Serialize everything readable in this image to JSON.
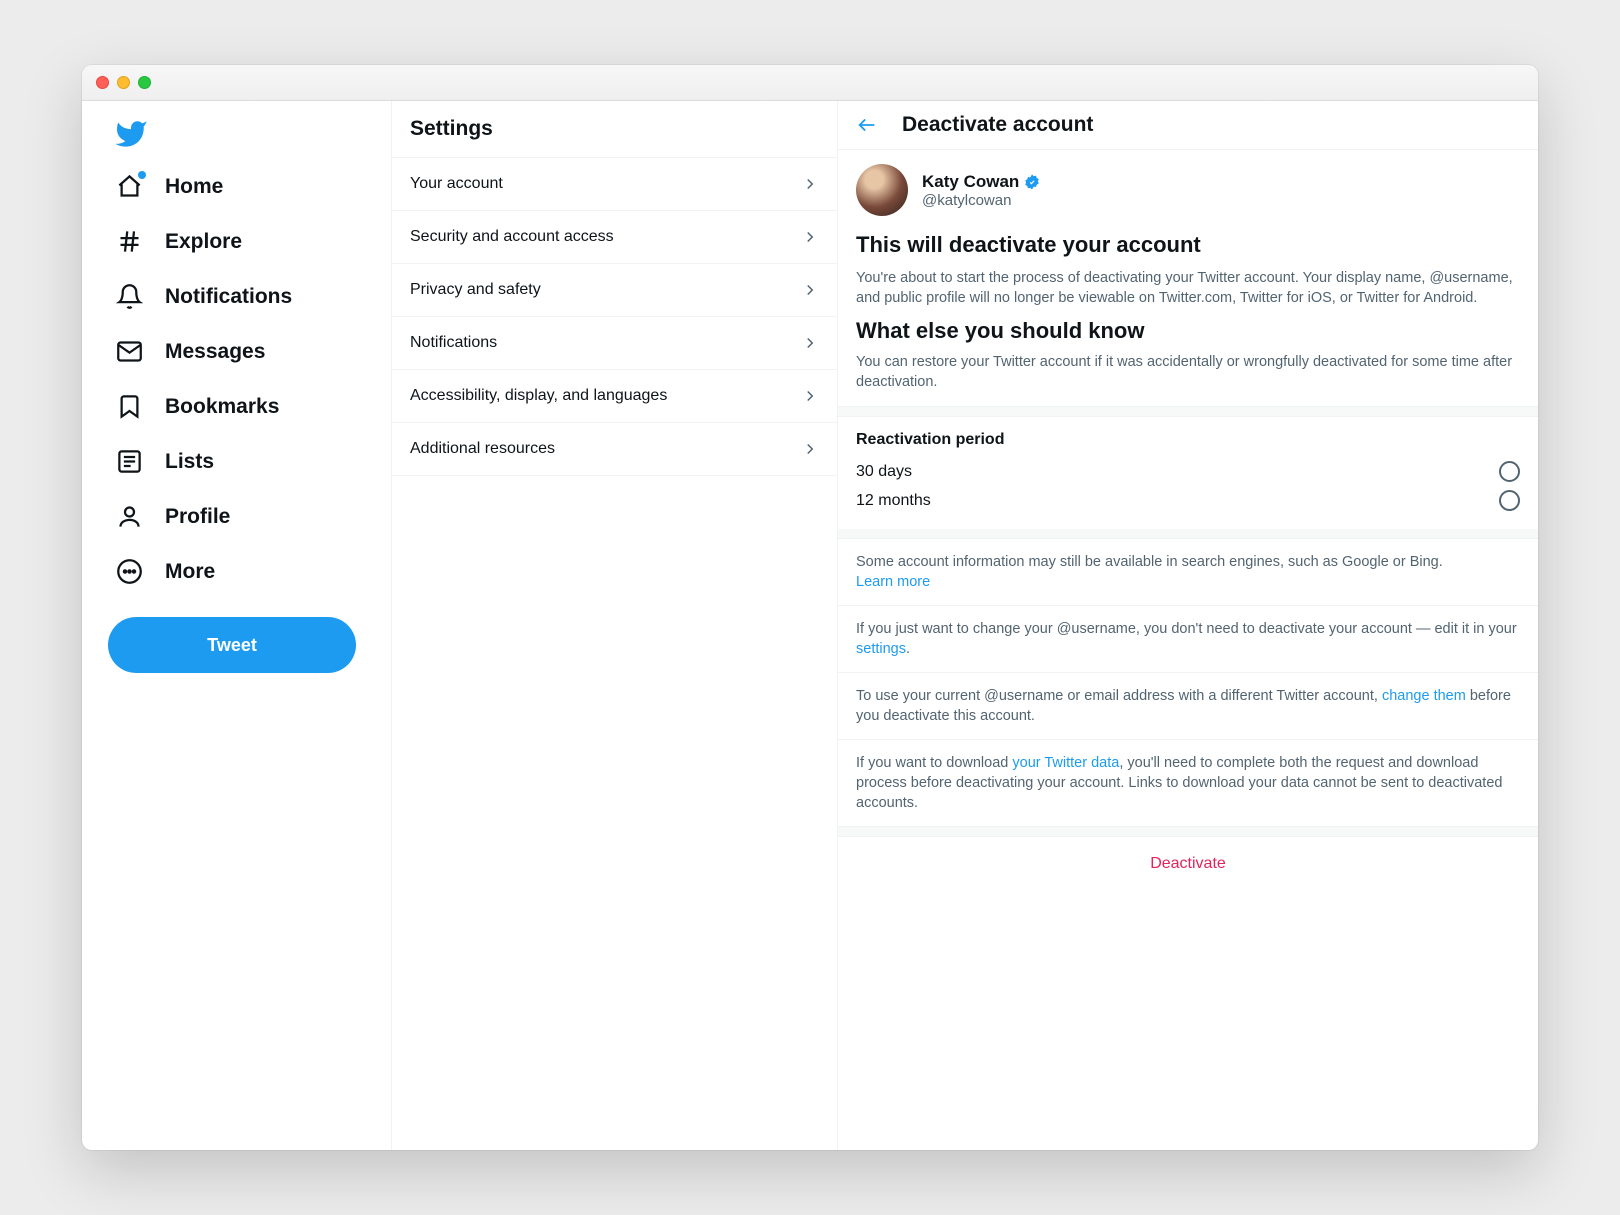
{
  "nav": {
    "items": [
      {
        "label": "Home"
      },
      {
        "label": "Explore"
      },
      {
        "label": "Notifications"
      },
      {
        "label": "Messages"
      },
      {
        "label": "Bookmarks"
      },
      {
        "label": "Lists"
      },
      {
        "label": "Profile"
      },
      {
        "label": "More"
      }
    ],
    "tweet_label": "Tweet"
  },
  "settings": {
    "title": "Settings",
    "items": [
      {
        "label": "Your account"
      },
      {
        "label": "Security and account access"
      },
      {
        "label": "Privacy and safety"
      },
      {
        "label": "Notifications"
      },
      {
        "label": "Accessibility, display, and languages"
      },
      {
        "label": "Additional resources"
      }
    ]
  },
  "main": {
    "title": "Deactivate account",
    "user": {
      "name": "Katy Cowan",
      "handle": "@katylcowan"
    },
    "deactivate_heading": "This will deactivate your account",
    "deactivate_text": "You're about to start the process of deactivating your Twitter account. Your display name, @username, and public profile will no longer be viewable on Twitter.com, Twitter for iOS, or Twitter for Android.",
    "know_heading": "What else you should know",
    "know_text": "You can restore your Twitter account if it was accidentally or wrongfully deactivated for some time after deactivation.",
    "reactivation": {
      "title": "Reactivation period",
      "options": [
        {
          "label": "30 days"
        },
        {
          "label": "12 months"
        }
      ]
    },
    "info": {
      "search_engines_pre": "Some account information may still be available in search engines, such as Google or Bing. ",
      "learn_more": "Learn more",
      "username_pre": "If you just want to change your @username, you don't need to deactivate your account — edit it in your ",
      "settings_link": "settings",
      "username_post": ".",
      "reuse_pre": "To use your current @username or email address with a different Twitter account, ",
      "change_them": "change them",
      "reuse_post": " before you deactivate this account.",
      "download_pre": "If you want to download ",
      "twitter_data_link": "your Twitter data",
      "download_post": ", you'll need to complete both the request and download process before deactivating your account. Links to download your data cannot be sent to deactivated accounts."
    },
    "deactivate_button": "Deactivate"
  }
}
